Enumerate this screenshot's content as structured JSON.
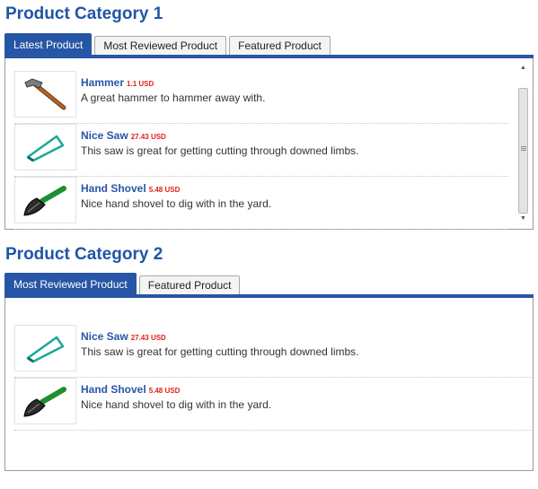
{
  "category1": {
    "title": "Product Category 1",
    "tabs": [
      {
        "label": "Latest Product",
        "active": true
      },
      {
        "label": "Most Reviewed Product",
        "active": false
      },
      {
        "label": "Featured Product",
        "active": false
      }
    ],
    "products": [
      {
        "name": "Hammer",
        "price": "1.1 USD",
        "description": "A great hammer to hammer away with.",
        "icon": "hammer-icon"
      },
      {
        "name": "Nice Saw",
        "price": "27.43 USD",
        "description": "This saw is great for getting cutting through downed limbs.",
        "icon": "saw-icon"
      },
      {
        "name": "Hand Shovel",
        "price": "5.48 USD",
        "description": "Nice hand shovel to dig with in the yard.",
        "icon": "shovel-icon"
      }
    ],
    "scrollbar": {
      "up": "▲",
      "down": "▼"
    }
  },
  "category2": {
    "title": "Product Category 2",
    "tabs": [
      {
        "label": "Most Reviewed Product",
        "active": true
      },
      {
        "label": "Featured Product",
        "active": false
      }
    ],
    "products": [
      {
        "name": "Nice Saw",
        "price": "27.43 USD",
        "description": "This saw is great for getting cutting through downed limbs.",
        "icon": "saw-icon"
      },
      {
        "name": "Hand Shovel",
        "price": "5.48 USD",
        "description": "Nice hand shovel to dig with in the yard.",
        "icon": "shovel-icon"
      }
    ]
  },
  "colors": {
    "accent": "#2756a6",
    "title": "#1f56a6",
    "price": "#e0231d"
  }
}
